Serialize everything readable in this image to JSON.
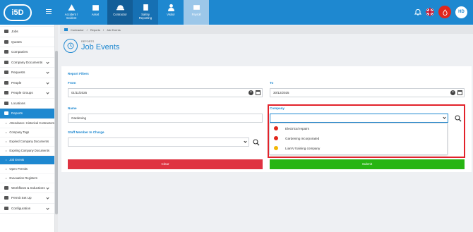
{
  "app": {
    "logo": "i5D"
  },
  "nav": [
    {
      "label": "Accident /\nIncident",
      "icon": "warning-icon"
    },
    {
      "label": "Asset",
      "icon": "asset-icon"
    },
    {
      "label": "Contractor",
      "icon": "hardhat-icon"
    },
    {
      "label": "Safety\nReporting",
      "icon": "clipboard-icon"
    },
    {
      "label": "Visitor",
      "icon": "person-icon"
    },
    {
      "label": "Payroll",
      "icon": "payroll-icon"
    }
  ],
  "user": {
    "initials": "HD"
  },
  "sidebar": {
    "items_top": [
      {
        "label": "Jobs",
        "chevron": false
      },
      {
        "label": "Quotes",
        "chevron": false
      },
      {
        "label": "Companies",
        "chevron": false
      },
      {
        "label": "Company Documents",
        "chevron": true
      },
      {
        "label": "Requests",
        "chevron": true
      },
      {
        "label": "People",
        "chevron": true
      },
      {
        "label": "People Groups",
        "chevron": true
      },
      {
        "label": "Locations",
        "chevron": false
      },
      {
        "label": "Reports",
        "chevron": true
      }
    ],
    "report_subitems": [
      "Attendance: Historical Contractors",
      "Company Tags",
      "Expired Company Documents",
      "Expiring Company Documents",
      "Job Events",
      "Open Permits",
      "Evacuation Registers"
    ],
    "items_bottom": [
      {
        "label": "Workflows & Inductions",
        "chevron": true
      },
      {
        "label": "Permit Set Up",
        "chevron": true
      },
      {
        "label": "Configuration",
        "chevron": true
      }
    ]
  },
  "breadcrumb": [
    "Contractor",
    "Reports",
    "Job Events"
  ],
  "page": {
    "eyebrow": "REPORTS",
    "title": "Job Events"
  },
  "filters": {
    "heading": "Report Filters",
    "from_label": "From",
    "from_value": "01/11/2025",
    "to_label": "To",
    "to_value": "30/12/2025",
    "name_label": "Name",
    "name_value": "Gardening",
    "company_label": "Company",
    "company_value": "",
    "staff_label": "Staff Member In Charge",
    "staff_value": "",
    "clear_label": "Clear",
    "submit_label": "Submit"
  },
  "company_options": [
    {
      "label": "Electrical repairs",
      "color": "#e1261c"
    },
    {
      "label": "Gardening incorporated",
      "color": "#e1261c"
    },
    {
      "label": "LiamV training company",
      "color": "#f2b705"
    }
  ],
  "colors": {
    "primary": "#1e88d0",
    "clear": "#df3341",
    "submit": "#27b512",
    "highlight": "#e2222a"
  }
}
